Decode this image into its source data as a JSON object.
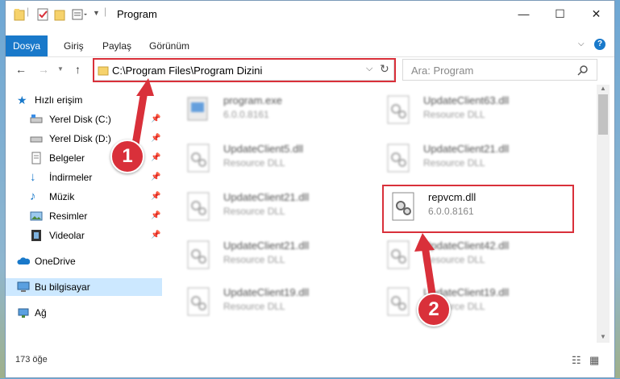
{
  "window": {
    "title": "Program",
    "controls": [
      "—",
      "☐",
      "✕"
    ]
  },
  "ribbon": {
    "tabs": [
      {
        "label": "Dosya",
        "active": true
      },
      {
        "label": "Giriş",
        "active": false
      },
      {
        "label": "Paylaş",
        "active": false
      },
      {
        "label": "Görünüm",
        "active": false
      }
    ]
  },
  "navigation": {
    "address": "C:\\Program Files\\Program Dizini",
    "search_placeholder": "Ara: Program"
  },
  "sidebar": {
    "items": [
      {
        "label": "Hızlı erişim",
        "icon": "star-icon",
        "pinned": false
      },
      {
        "label": "Yerel Disk (C:)",
        "icon": "drive-icon",
        "pinned": true
      },
      {
        "label": "Yerel Disk (D:)",
        "icon": "drive-icon",
        "pinned": true
      },
      {
        "label": "Belgeler",
        "icon": "document-icon",
        "pinned": true
      },
      {
        "label": "İndirmeler",
        "icon": "download-icon",
        "pinned": true
      },
      {
        "label": "Müzik",
        "icon": "music-icon",
        "pinned": true
      },
      {
        "label": "Resimler",
        "icon": "picture-icon",
        "pinned": true
      },
      {
        "label": "Videolar",
        "icon": "video-icon",
        "pinned": true
      },
      {
        "label": "OneDrive",
        "icon": "cloud-icon",
        "pinned": false
      },
      {
        "label": "Bu bilgisayar",
        "icon": "computer-icon",
        "pinned": false,
        "selected": true
      },
      {
        "label": "Ağ",
        "icon": "network-icon",
        "pinned": false
      }
    ]
  },
  "files": [
    {
      "name": "program.exe",
      "desc": "6.0.0.8161",
      "blurred": true
    },
    {
      "name": "UpdateClient63.dll",
      "desc": "Resource DLL",
      "blurred": true
    },
    {
      "name": "UpdateClient5.dll",
      "desc": "Resource DLL",
      "blurred": true
    },
    {
      "name": "UpdateClient21.dll",
      "desc": "Resource DLL",
      "blurred": true
    },
    {
      "name": "UpdateClient21.dll",
      "desc": "Resource DLL",
      "blurred": true
    },
    {
      "name": "repvcm.dll",
      "desc": "6.0.0.8161",
      "blurred": false
    },
    {
      "name": "UpdateClient21.dll",
      "desc": "Resource DLL",
      "blurred": true
    },
    {
      "name": "UpdateClient42.dll",
      "desc": "Resource DLL",
      "blurred": true
    },
    {
      "name": "UpdateClient19.dll",
      "desc": "Resource DLL",
      "blurred": true
    },
    {
      "name": "UpdateClient19.dll",
      "desc": "Resource DLL",
      "blurred": true
    }
  ],
  "status": {
    "item_count": "173 öğe"
  },
  "annotations": {
    "badge1": "1",
    "badge2": "2",
    "highlight_color": "#d9303a"
  }
}
